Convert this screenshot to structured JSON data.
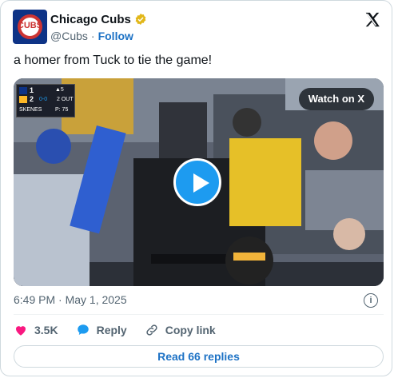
{
  "account": {
    "name": "Chicago Cubs",
    "handle": "@Cubs",
    "separator": "·",
    "follow_label": "Follow",
    "avatar_text": "CUBS"
  },
  "tweet": {
    "text": "a homer from Tuck to tie the game!",
    "timestamp": "6:49 PM · May 1, 2025"
  },
  "media": {
    "watch_label": "Watch on X",
    "scorebug": {
      "away_score": "1",
      "home_score": "2",
      "inning": "▲5",
      "count": "0-0",
      "outs": "2 OUT",
      "pitcher": "SKENES",
      "pitch_count": "P: 75"
    }
  },
  "actions": {
    "likes": "3.5K",
    "reply_label": "Reply",
    "copy_label": "Copy link"
  },
  "read_replies_label": "Read 66 replies",
  "colors": {
    "like": "#f91880",
    "reply": "#1d9bf0",
    "link": "#1d72c5",
    "verified": "#e2b719"
  }
}
